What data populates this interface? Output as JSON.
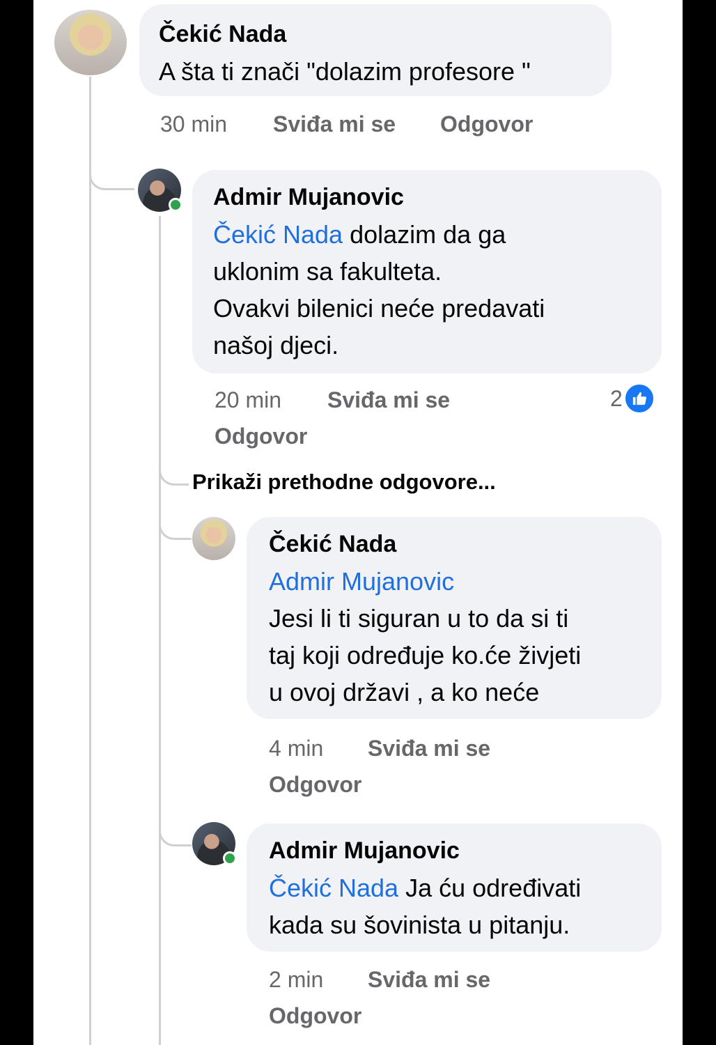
{
  "comments": [
    {
      "author": "Čekić Nada",
      "text": "A šta ti znači \"dolazim profesore \"",
      "time": "30 min",
      "like": "Sviđa mi se",
      "reply": "Odgovor"
    },
    {
      "author": "Admir Mujanovic",
      "mention": "Čekić Nada",
      "line1": " dolazim da ga",
      "line2": "uklonim sa fakulteta.",
      "line3": "Ovakvi bilenici neće predavati",
      "line4": "našoj djeci.",
      "time": "20 min",
      "like": "Sviđa mi se",
      "reply": "Odgovor",
      "reaction_count": "2"
    },
    {
      "author": "Čekić Nada",
      "mention": "Admir Mujanovic",
      "line1": "Jesi li ti siguran u to da si ti",
      "line2": "taj koji određuje ko.će živjeti",
      "line3": "u ovoj državi , a ko neće",
      "time": "4 min",
      "like": "Sviđa mi se",
      "reply": "Odgovor"
    },
    {
      "author": "Admir Mujanovic",
      "mention": "Čekić Nada",
      "line1": " Ja ću određivati",
      "line2": "kada su šovinista u pitanju.",
      "time": "2 min",
      "like": "Sviđa mi se",
      "reply": "Odgovor"
    }
  ],
  "show_previous": "Prikaži prethodne odgovore...",
  "colors": {
    "mention": "#216fdb",
    "bubble": "#f0f2f5",
    "like_badge": "#1877f2",
    "online": "#31a24c"
  },
  "icons": {
    "reaction": "thumbs-up-icon"
  }
}
